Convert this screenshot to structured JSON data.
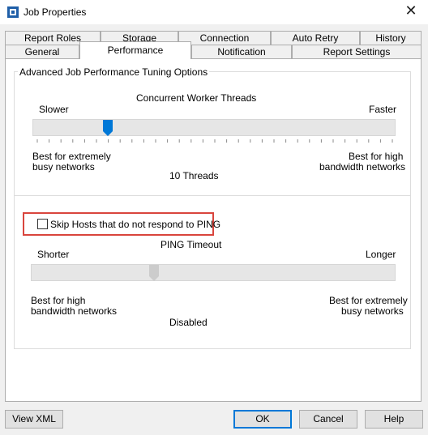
{
  "window": {
    "title": "Job Properties",
    "close_glyph": "✕"
  },
  "tabs_row1": [
    "Report Roles",
    "Storage",
    "Connection",
    "Auto Retry",
    "History"
  ],
  "tabs_row2": [
    "General",
    "Performance",
    "Notification",
    "Report Settings"
  ],
  "active_tab": "Performance",
  "group": {
    "title": "Advanced Job Performance Tuning Options"
  },
  "threads": {
    "heading": "Concurrent Worker Threads",
    "left_label": "Slower",
    "right_label": "Faster",
    "desc_left": [
      "Best for extremely",
      "busy networks"
    ],
    "desc_right": [
      "Best for high",
      "bandwidth networks"
    ],
    "value_text": "10 Threads",
    "slider_fraction": 0.195,
    "thumb_color": "#0078d7"
  },
  "ping": {
    "checkbox_label": "Skip Hosts that do not respond to PING",
    "checked": false,
    "heading": "PING Timeout",
    "left_label": "Shorter",
    "right_label": "Longer",
    "desc_left": [
      "Best for high",
      "bandwidth networks"
    ],
    "desc_right": [
      "Best for extremely",
      "busy networks"
    ],
    "value_text": "Disabled",
    "slider_fraction": 0.33,
    "thumb_color": "#cccccc",
    "highlight_color": "#d9453d"
  },
  "buttons": {
    "view_xml": "View XML",
    "ok": "OK",
    "cancel": "Cancel",
    "help": "Help"
  }
}
